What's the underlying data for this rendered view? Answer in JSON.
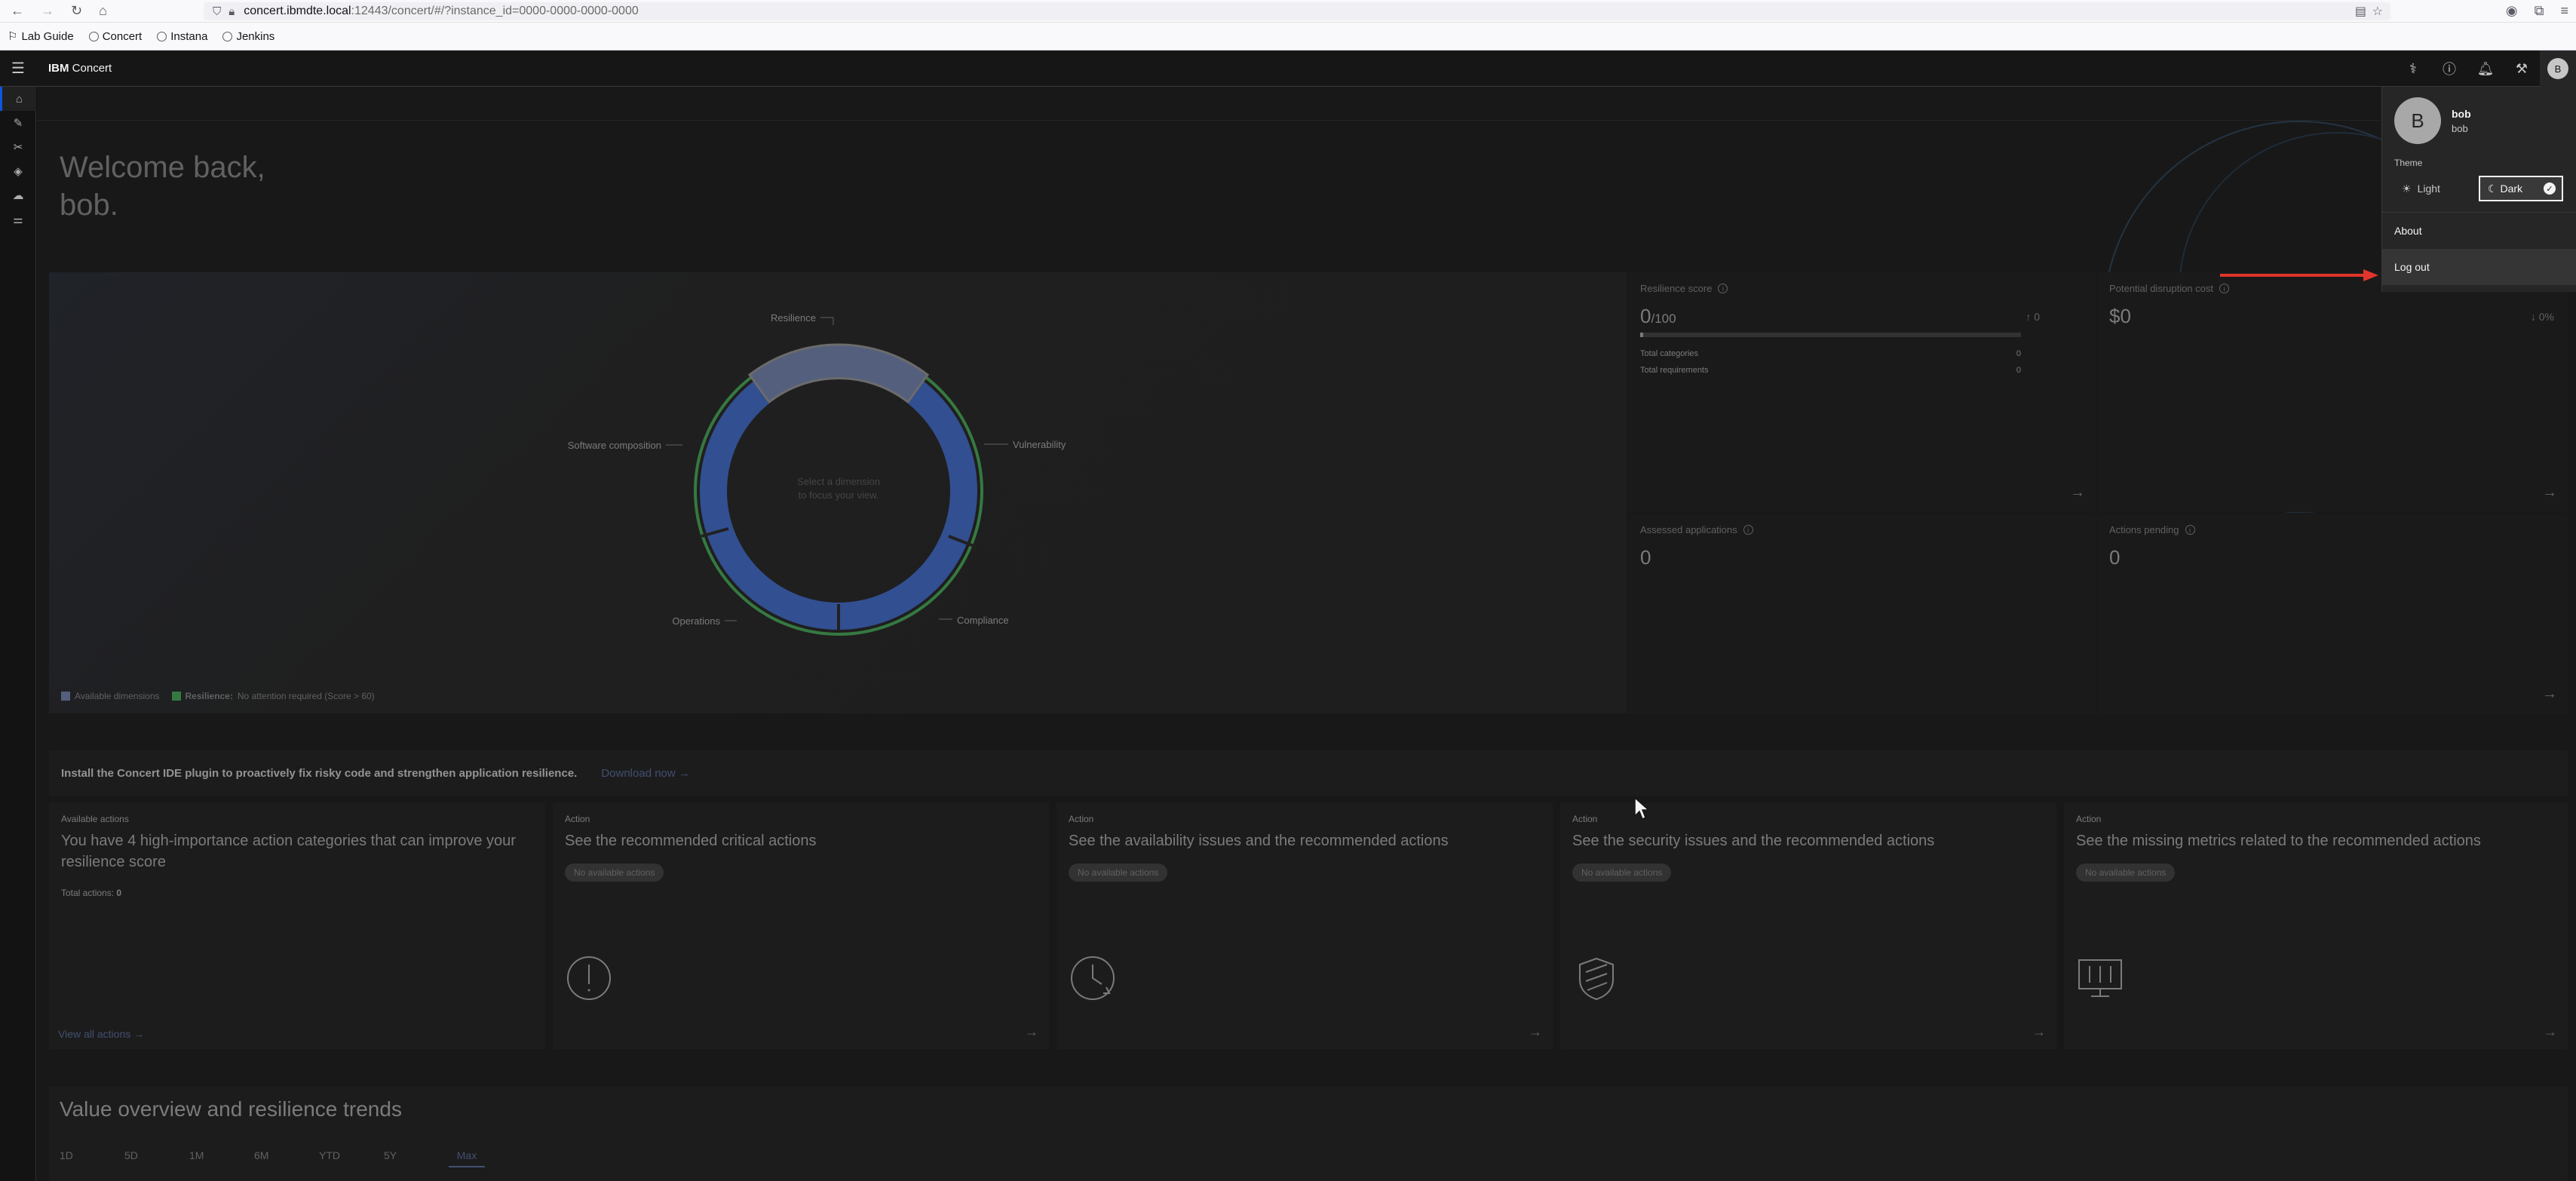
{
  "browser": {
    "url_host": "concert.ibmdte.local",
    "url_rest": ":12443/concert/#/?instance_id=0000-0000-0000-0000",
    "bookmarks": [
      "Lab Guide",
      "Concert",
      "Instana",
      "Jenkins"
    ]
  },
  "header": {
    "brand": "IBM",
    "product": "Concert",
    "avatar_initial": "B"
  },
  "welcome": {
    "line1": "Welcome back,",
    "line2": "bob."
  },
  "viz": {
    "center_text_1": "Select a dimension",
    "center_text_2": "to focus your view.",
    "labels": {
      "resilience": "Resilience",
      "vulnerability": "Vulnerability",
      "compliance": "Compliance",
      "operations": "Operations",
      "software": "Software composition"
    },
    "legend_available": "Available dimensions",
    "legend_resilience_bold": "Resilience:",
    "legend_resilience_text": "No attention required (Score > 60)"
  },
  "tiles": {
    "resilience": {
      "label": "Resilience score",
      "value": "0",
      "suffix": "/100",
      "trend": "↑ 0",
      "cat_label": "Total categories",
      "cat_value": "0",
      "req_label": "Total requirements",
      "req_value": "0"
    },
    "disruption": {
      "label": "Potential disruption cost",
      "value": "$0",
      "trend": "↓ 0%"
    },
    "assessed": {
      "label": "Assessed applications",
      "value": "0"
    },
    "actions": {
      "label": "Actions pending",
      "value": "0"
    }
  },
  "banner": {
    "text": "Install the Concert IDE plugin to proactively fix risky code and strengthen application resilience.",
    "link": "Download now"
  },
  "cards": {
    "available": {
      "eyebrow": "Available actions",
      "title": "You have 4 high-importance action categories that can improve your resilience score",
      "total_label": "Total actions:",
      "total_value": "0",
      "link": "View all actions"
    },
    "critical": {
      "eyebrow": "Action",
      "title": "See the recommended critical actions",
      "tag": "No available actions"
    },
    "availability": {
      "eyebrow": "Action",
      "title": "See the availability issues and the recommended actions",
      "tag": "No available actions"
    },
    "security": {
      "eyebrow": "Action",
      "title": "See the security issues and the recommended actions",
      "tag": "No available actions"
    },
    "metrics": {
      "eyebrow": "Action",
      "title": "See the missing metrics related to the recommended actions",
      "tag": "No available actions"
    }
  },
  "value_overview": {
    "title": "Value overview and resilience trends",
    "tabs": [
      "1D",
      "5D",
      "1M",
      "6M",
      "YTD",
      "5Y",
      "Max"
    ],
    "selected": "Max"
  },
  "profile_menu": {
    "initial": "B",
    "name": "bob",
    "username": "bob",
    "theme_label": "Theme",
    "theme_light": "Light",
    "theme_dark": "Dark",
    "selected_theme": "Dark",
    "about": "About",
    "logout": "Log out"
  },
  "colors": {
    "accent": "#0f62fe",
    "annotation_arrow": "#e0352b",
    "ring_blue": "#3a5aa6",
    "ring_green": "#3d8a4a"
  }
}
